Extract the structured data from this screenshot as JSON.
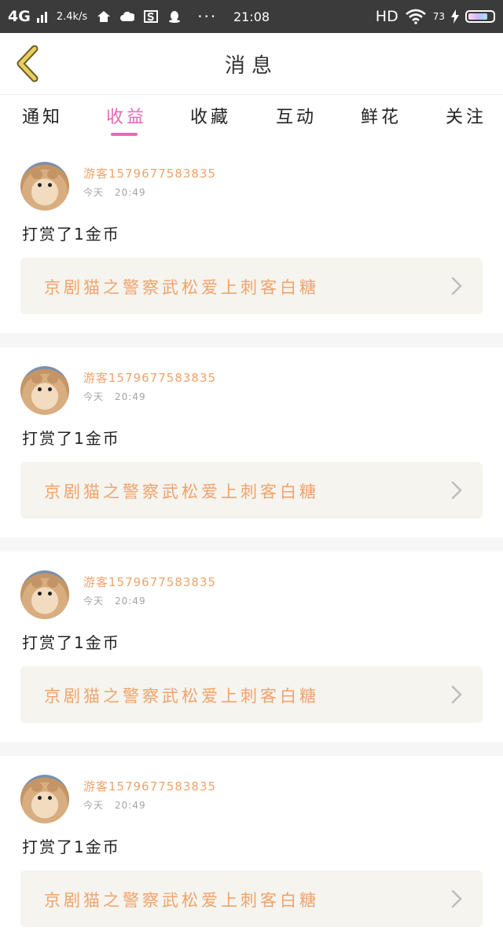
{
  "status_bar": {
    "network": "4G",
    "speed": "2.4k/s",
    "time": "21:08",
    "hd": "HD",
    "battery_pct": "73",
    "dots": "···"
  },
  "nav": {
    "title": "消息"
  },
  "tabs": [
    {
      "label": "通知"
    },
    {
      "label": "收益",
      "active": true
    },
    {
      "label": "收藏"
    },
    {
      "label": "互动"
    },
    {
      "label": "鲜花"
    },
    {
      "label": "关注"
    }
  ],
  "messages": [
    {
      "user": "游客1579677583835",
      "day": "今天",
      "time": "20:49",
      "text": "打赏了1金币",
      "link": "京剧猫之警察武松爱上刺客白糖"
    },
    {
      "user": "游客1579677583835",
      "day": "今天",
      "time": "20:49",
      "text": "打赏了1金币",
      "link": "京剧猫之警察武松爱上刺客白糖"
    },
    {
      "user": "游客1579677583835",
      "day": "今天",
      "time": "20:49",
      "text": "打赏了1金币",
      "link": "京剧猫之警察武松爱上刺客白糖"
    },
    {
      "user": "游客1579677583835",
      "day": "今天",
      "time": "20:49",
      "text": "打赏了1金币",
      "link": "京剧猫之警察武松爱上刺客白糖"
    }
  ],
  "colors": {
    "accent": "#e76ab7",
    "username": "#f0a36b",
    "link": "#f0a36b",
    "back_arrow": "#e8cf5a"
  }
}
